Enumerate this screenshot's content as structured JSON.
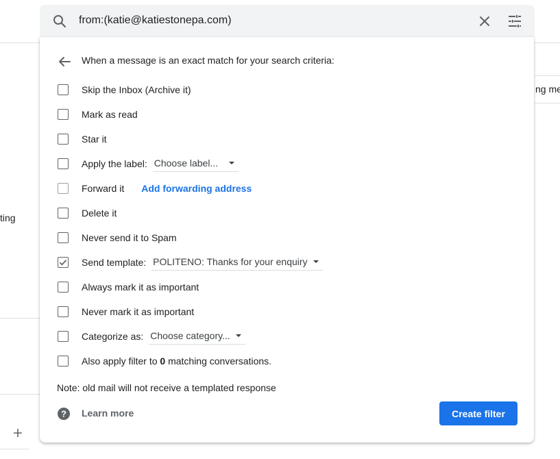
{
  "background": {
    "partial_text_right": "ng me",
    "partial_text_left": "ting"
  },
  "search": {
    "query": "from:(katie@katiestonepa.com)",
    "icons": [
      "search-icon",
      "close-icon",
      "tune-icon"
    ]
  },
  "filter": {
    "heading": "When a message is an exact match for your search criteria:",
    "options": {
      "skip_inbox": "Skip the Inbox (Archive it)",
      "mark_read": "Mark as read",
      "star": "Star it",
      "apply_label": "Apply the label:",
      "label_select": "Choose label...",
      "forward": "Forward it",
      "add_forwarding": "Add forwarding address",
      "delete": "Delete it",
      "never_spam": "Never send it to Spam",
      "send_template": "Send template:",
      "template_select": "POLITENO: Thanks for your enquiry",
      "always_important": "Always mark it as important",
      "never_important": "Never mark it as important",
      "categorize": "Categorize as:",
      "category_select": "Choose category...",
      "also_apply_pre": "Also apply filter to ",
      "also_apply_count": "0",
      "also_apply_post": " matching conversations."
    },
    "checked": {
      "send_template": true
    },
    "note": "Note: old mail will not receive a templated response",
    "learn_more": "Learn more",
    "create_button": "Create filter"
  },
  "colors": {
    "accent": "#1a73e8",
    "search_bg": "#f1f3f4",
    "checkbox": "#5f6368"
  }
}
